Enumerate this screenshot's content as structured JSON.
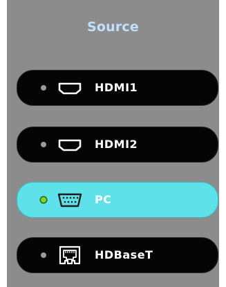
{
  "panel": {
    "title": "Source"
  },
  "sources": [
    {
      "label": "HDMI1",
      "icon": "hdmi-port-icon",
      "selected": false
    },
    {
      "label": "HDMI2",
      "icon": "hdmi-port-icon",
      "selected": false
    },
    {
      "label": "PC",
      "icon": "vga-port-icon",
      "selected": true
    },
    {
      "label": "HDBaseT",
      "icon": "ethernet-port-icon",
      "selected": false
    }
  ],
  "colors": {
    "panel_background": "#8c8c8c",
    "title": "#bfe0ff",
    "button": "#050505",
    "button_selected": "#5fe1ea",
    "led_inactive": "#9a9a9a",
    "led_active": "#7bd62a"
  }
}
